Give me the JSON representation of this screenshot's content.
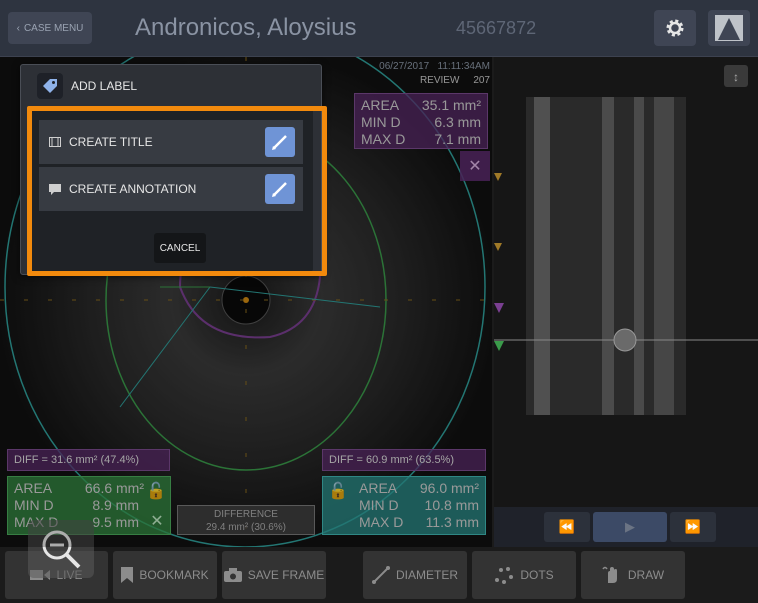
{
  "header": {
    "case_menu_label": "CASE MENU",
    "patient_name": "Andronicos, Aloysius",
    "patient_id": "45667872"
  },
  "frame_info": {
    "date": "06/27/2017",
    "time": "11:11:34AM",
    "mode": "REVIEW",
    "frame": "207"
  },
  "measurements": {
    "top": {
      "area_label": "AREA",
      "area": "35.1 mm²",
      "min_label": "MIN D",
      "min": "6.3 mm",
      "max_label": "MAX D",
      "max": "7.1 mm"
    },
    "left": {
      "diff": "DIFF = 31.6 mm² (47.4%)",
      "area_label": "AREA",
      "area": "66.6 mm²",
      "min_label": "MIN D",
      "min": "8.9 mm",
      "max_label": "MAX D",
      "max": "9.5 mm"
    },
    "right": {
      "diff": "DIFF = 60.9 mm² (63.5%)",
      "area_label": "AREA",
      "area": "96.0 mm²",
      "min_label": "MIN D",
      "min": "10.8 mm",
      "max_label": "MAX D",
      "max": "11.3 mm"
    },
    "difference": {
      "label": "DIFFERENCE",
      "value": "29.4 mm² (30.6%)"
    }
  },
  "toolbar": {
    "live": "LIVE",
    "bookmark": "BOOKMARK",
    "save_frame": "SAVE FRAME",
    "diameter": "DIAMETER",
    "dots": "DOTS",
    "draw": "DRAW"
  },
  "dialog": {
    "title": "ADD LABEL",
    "create_title": "CREATE TITLE",
    "create_annotation": "CREATE ANNOTATION",
    "cancel": "CANCEL"
  },
  "colors": {
    "highlight": "#f28a0d",
    "lumen_purple": "#7a3f91",
    "vessel_green": "#3a9a4a",
    "outer_teal": "#2f9e9a",
    "pen_button": "#6f94d6"
  }
}
